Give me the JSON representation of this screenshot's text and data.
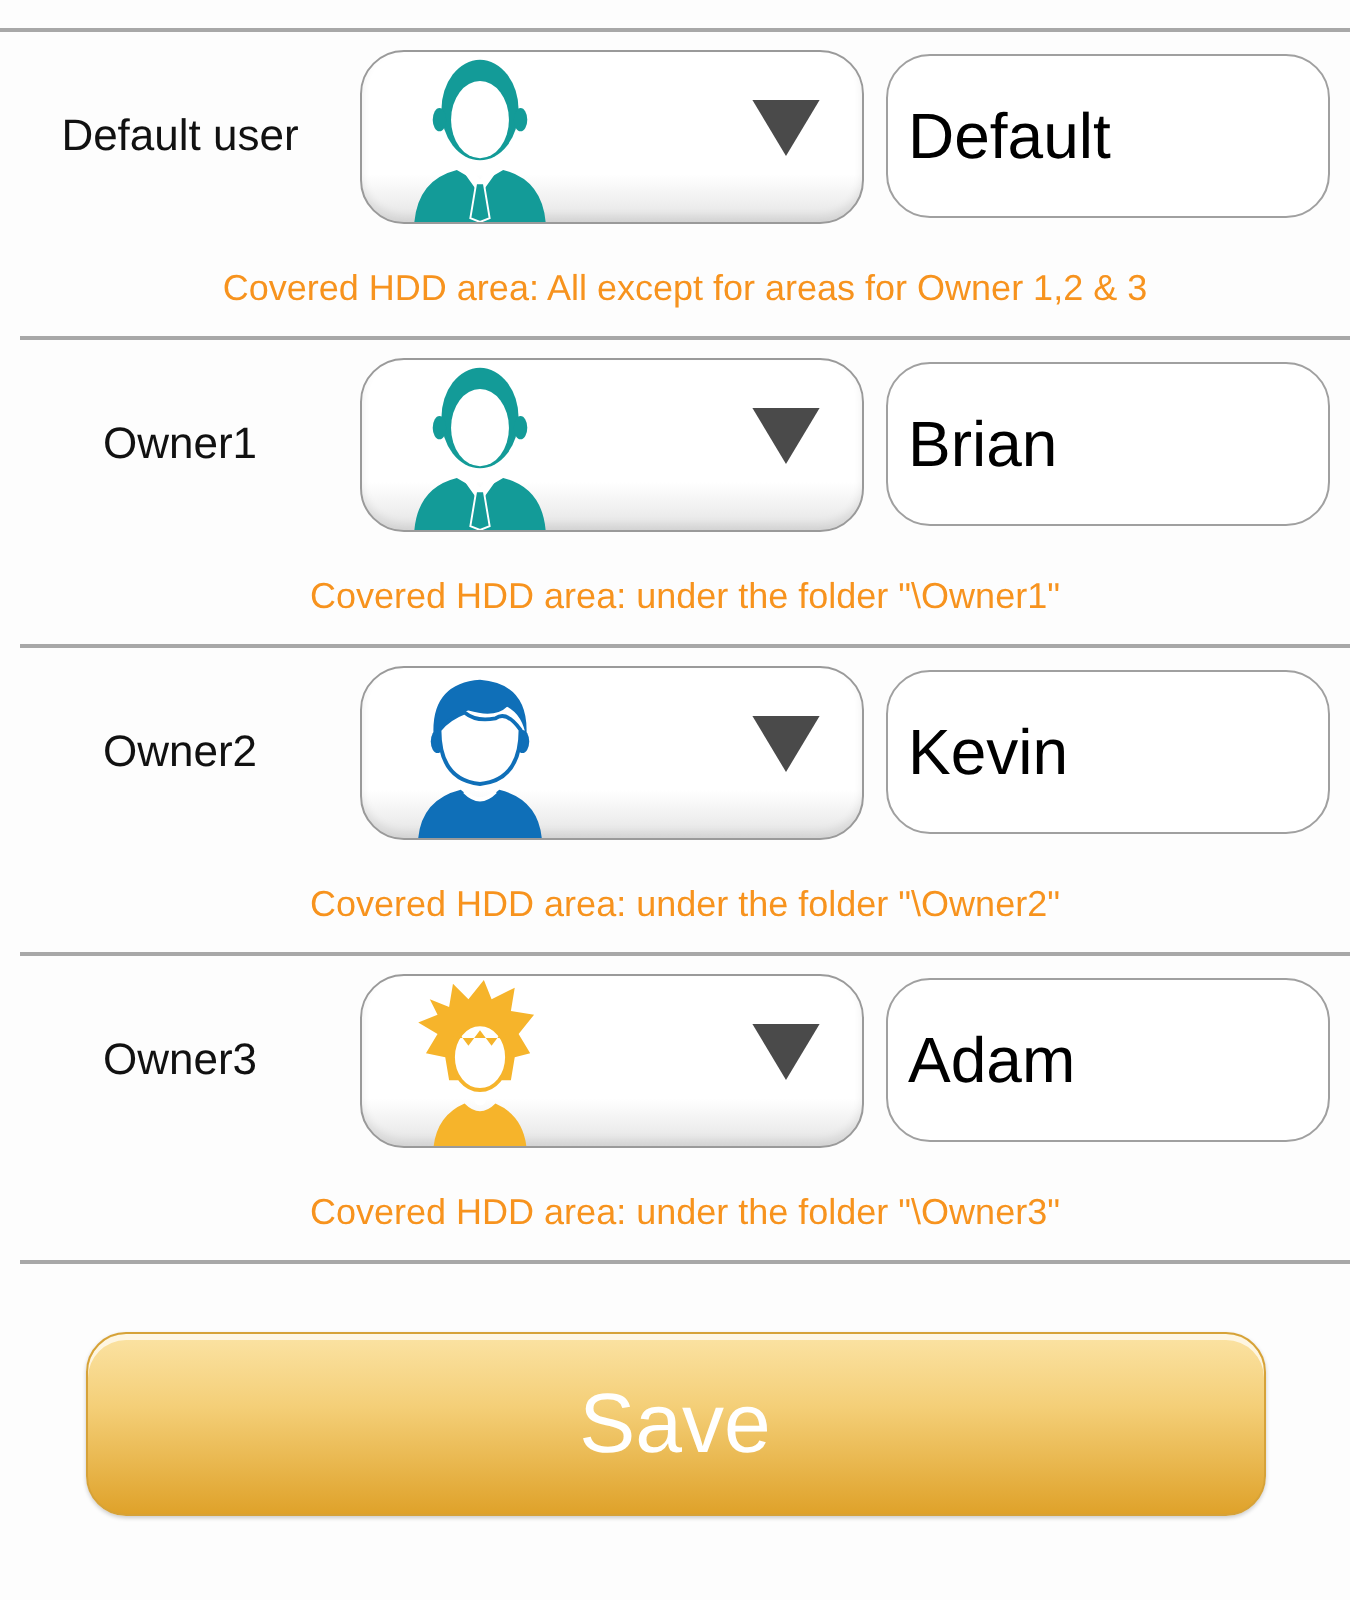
{
  "rows": [
    {
      "label": "Default user",
      "avatar": {
        "kind": "suit",
        "color": "#139b98"
      },
      "name": "Default",
      "note": "Covered HDD area: All except for areas for Owner 1,2 & 3"
    },
    {
      "label": "Owner1",
      "avatar": {
        "kind": "suit",
        "color": "#139b98"
      },
      "name": "Brian",
      "note": "Covered HDD area: under the folder \"\\Owner1\""
    },
    {
      "label": "Owner2",
      "avatar": {
        "kind": "shirt",
        "color": "#0f6fb8"
      },
      "name": "Kevin",
      "note": "Covered HDD area: under the folder \"\\Owner2\""
    },
    {
      "label": "Owner3",
      "avatar": {
        "kind": "spiky",
        "color": "#f6b42b"
      },
      "name": "Adam",
      "note": "Covered HDD area: under the folder \"\\Owner3\""
    }
  ],
  "save_button": {
    "label": "Save"
  }
}
